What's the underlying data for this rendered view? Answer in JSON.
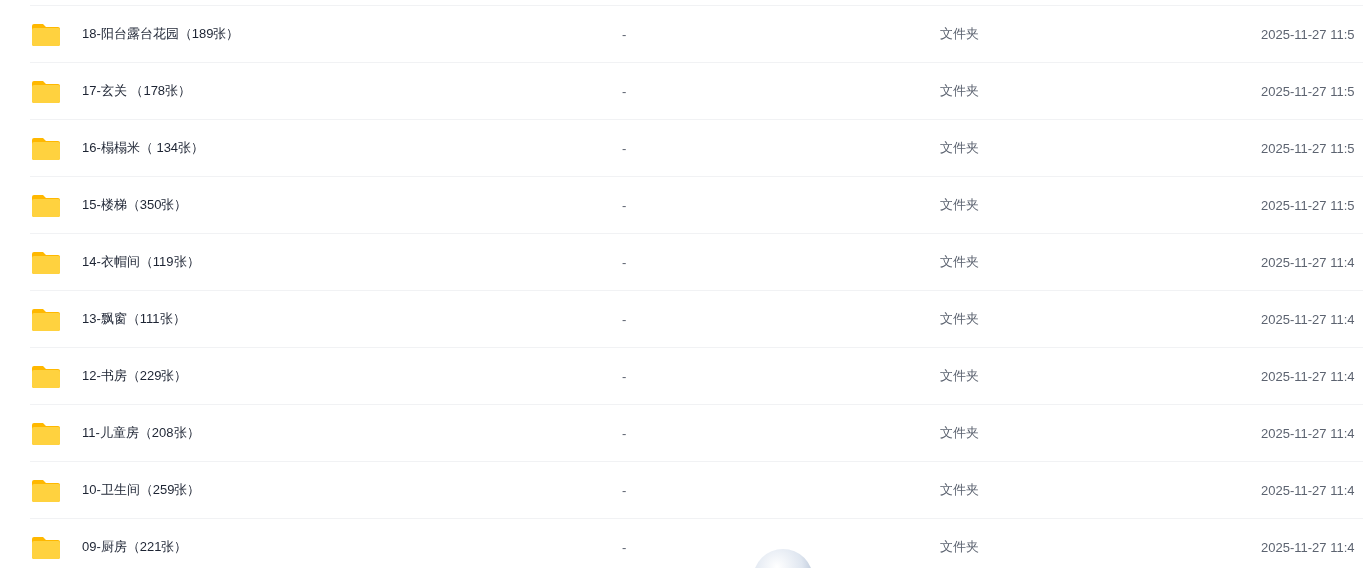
{
  "rows": [
    {
      "name": "18-阳台露台花园（189张）",
      "size": "-",
      "type": "文件夹",
      "modified": "2025-11-27 11:5"
    },
    {
      "name": "17-玄关 （178张）",
      "size": "-",
      "type": "文件夹",
      "modified": "2025-11-27 11:5"
    },
    {
      "name": "16-榻榻米（ 134张）",
      "size": "-",
      "type": "文件夹",
      "modified": "2025-11-27 11:5"
    },
    {
      "name": "15-楼梯（350张）",
      "size": "-",
      "type": "文件夹",
      "modified": "2025-11-27 11:5"
    },
    {
      "name": "14-衣帽间（119张）",
      "size": "-",
      "type": "文件夹",
      "modified": "2025-11-27 11:4"
    },
    {
      "name": "13-飘窗（111张）",
      "size": "-",
      "type": "文件夹",
      "modified": "2025-11-27 11:4"
    },
    {
      "name": "12-书房（229张）",
      "size": "-",
      "type": "文件夹",
      "modified": "2025-11-27 11:4"
    },
    {
      "name": "11-儿童房（208张）",
      "size": "-",
      "type": "文件夹",
      "modified": "2025-11-27 11:4"
    },
    {
      "name": "10-卫生间（259张）",
      "size": "-",
      "type": "文件夹",
      "modified": "2025-11-27 11:4"
    },
    {
      "name": "09-厨房（221张）",
      "size": "-",
      "type": "文件夹",
      "modified": "2025-11-27 11:4"
    }
  ]
}
